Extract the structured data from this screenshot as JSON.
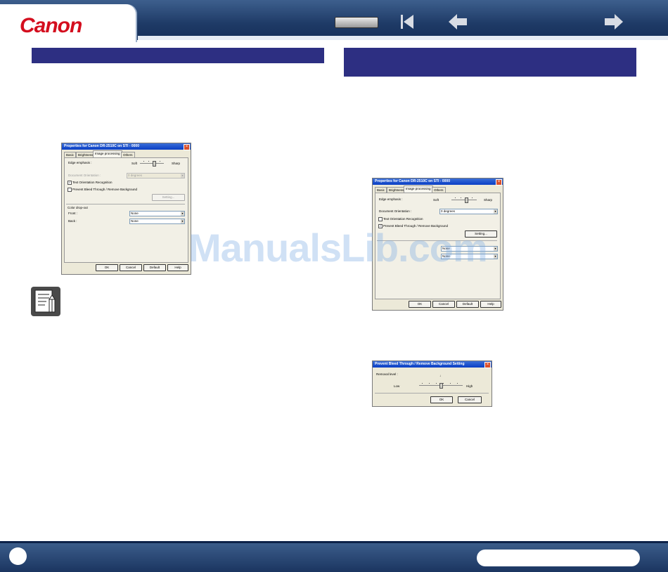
{
  "header": {
    "logo_text": "Canon",
    "nav_icons": [
      "nav-box",
      "first-page-icon",
      "back-arrow-icon",
      "forward-arrow-icon"
    ]
  },
  "watermark": "ManualsLib.com",
  "dialog1": {
    "title": "Properties for Canon DR-2510C on STI - 0000",
    "tabs": [
      "Basic",
      "Brightness",
      "Image processing",
      "Others"
    ],
    "active_tab": "Image processing",
    "edge_emphasis_label": "Edge emphasis :",
    "soft": "Soft",
    "sharp": "Sharp",
    "doc_orientation_label": "Document Orientation :",
    "doc_orientation_value": "0 degrees",
    "text_orientation": "Text Orientation Recognition",
    "text_orientation_checked": "✓",
    "prevent_bleed": "Prevent Bleed Through / Remove Background",
    "setting": "Setting...",
    "color_dropout": "Color drop-out",
    "front_label": "Front :",
    "front_value": "None",
    "back_label": "Back :",
    "back_value": "None",
    "buttons": [
      "OK",
      "Cancel",
      "Default",
      "Help"
    ]
  },
  "dialog2": {
    "title": "Properties for Canon DR-2510C on STI - 0000",
    "tabs": [
      "Basic",
      "Brightness",
      "Image processing",
      "Others"
    ],
    "active_tab": "Image processing",
    "edge_emphasis_label": "Edge emphasis :",
    "soft": "Soft",
    "sharp": "Sharp",
    "doc_orientation_label": "Document Orientation :",
    "doc_orientation_value": "0 degrees",
    "text_orientation": "Text Orientation Recognition",
    "prevent_bleed": "Prevent Bleed Through / Remove Background",
    "prevent_bleed_checked": "✓",
    "setting": "Setting...",
    "front_value": "None",
    "back_value": "None",
    "buttons": [
      "OK",
      "Cancel",
      "Default",
      "Help"
    ]
  },
  "dialog3": {
    "title": "Prevent Bleed Through / Remove Background Setting",
    "removal_level_label": "Removal level :",
    "low": "Low",
    "high": "High",
    "buttons": [
      "OK",
      "Cancel"
    ]
  },
  "colors": {
    "header_bg": "#1e3a66",
    "section_bar": "#2d2f82",
    "logo": "#d40e1e"
  }
}
